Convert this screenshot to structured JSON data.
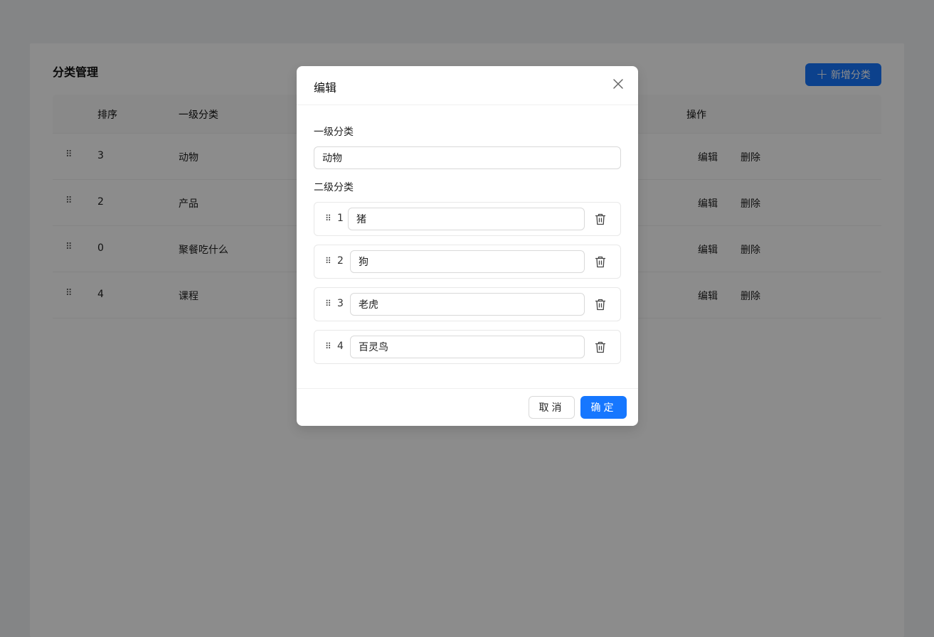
{
  "page": {
    "title": "分类管理",
    "add_button": "新增分类"
  },
  "table": {
    "headers": {
      "order": "排序",
      "level1": "一级分类",
      "actions": "操作"
    },
    "rows": [
      {
        "order": "3",
        "name": "动物",
        "edit": "编辑",
        "delete": "删除"
      },
      {
        "order": "2",
        "name": "产品",
        "edit": "编辑",
        "delete": "删除"
      },
      {
        "order": "0",
        "name": "聚餐吃什么",
        "edit": "编辑",
        "delete": "删除"
      },
      {
        "order": "4",
        "name": "课程",
        "edit": "编辑",
        "delete": "删除"
      }
    ],
    "drag_glyph": "⠿"
  },
  "modal": {
    "title": "编辑",
    "level1_label": "一级分类",
    "level1_value": "动物",
    "level2_label": "二级分类",
    "sub_items": [
      {
        "num": "1",
        "value": "猪"
      },
      {
        "num": "2",
        "value": "狗"
      },
      {
        "num": "3",
        "value": "老虎"
      },
      {
        "num": "4",
        "value": "百灵鸟"
      }
    ],
    "cancel_label": "取消",
    "ok_label": "确定"
  },
  "colors": {
    "primary": "#1677ff",
    "mask": "rgba(0,0,0,0.45)"
  }
}
